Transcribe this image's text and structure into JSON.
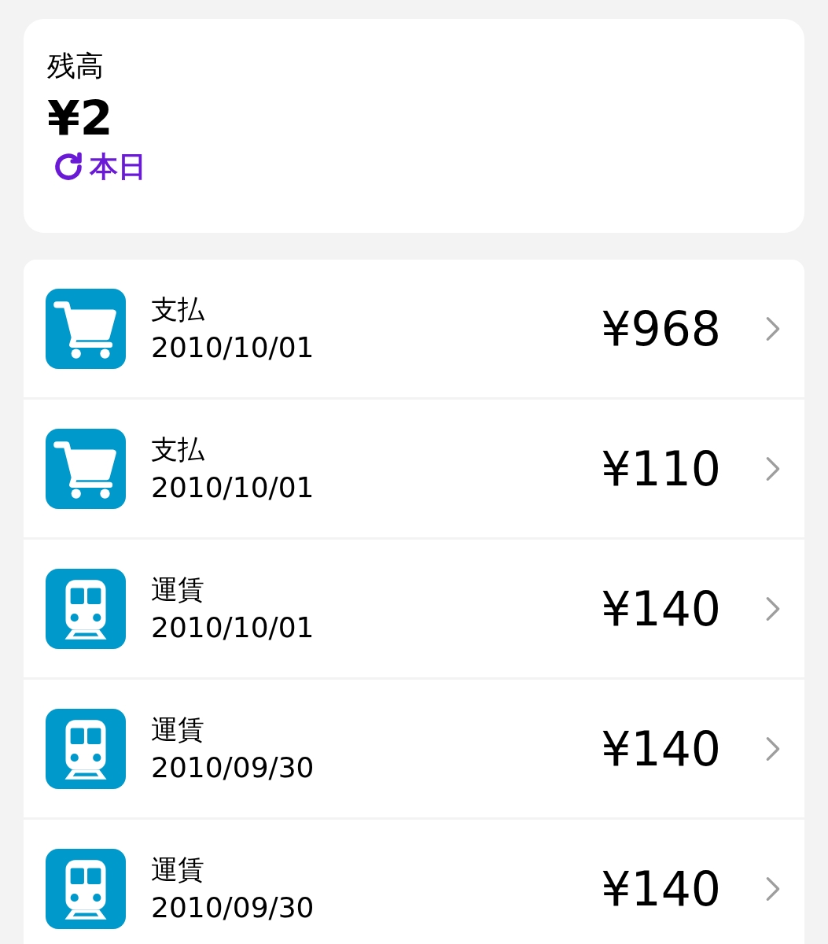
{
  "balance": {
    "label": "残高",
    "amount": "¥2",
    "updated": "本日"
  },
  "transactions": [
    {
      "kind": "cart",
      "title": "支払",
      "date": "2010/10/01",
      "amount": "¥968"
    },
    {
      "kind": "cart",
      "title": "支払",
      "date": "2010/10/01",
      "amount": "¥110"
    },
    {
      "kind": "train",
      "title": "運賃",
      "date": "2010/10/01",
      "amount": "¥140"
    },
    {
      "kind": "train",
      "title": "運賃",
      "date": "2010/09/30",
      "amount": "¥140"
    },
    {
      "kind": "train",
      "title": "運賃",
      "date": "2010/09/30",
      "amount": "¥140"
    }
  ]
}
